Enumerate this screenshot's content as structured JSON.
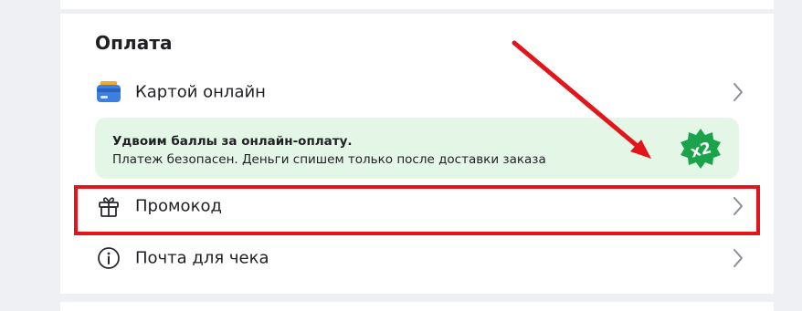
{
  "section": {
    "title": "Оплата"
  },
  "payment_method": {
    "label": "Картой онлайн",
    "icon": "card-wallet-icon"
  },
  "bonus_banner": {
    "headline": "Удвоим баллы за онлайн-оплату.",
    "text": "Платеж безопасен. Деньги спишем только после доставки заказа",
    "badge_text": "x2",
    "badge_color": "#1aa34a",
    "background": "#e4f7e6"
  },
  "promo_row": {
    "label": "Промокод",
    "icon": "gift-icon"
  },
  "receipt_row": {
    "label": "Почта для чека",
    "icon": "info-icon"
  },
  "annotation": {
    "color": "#e4141b"
  }
}
